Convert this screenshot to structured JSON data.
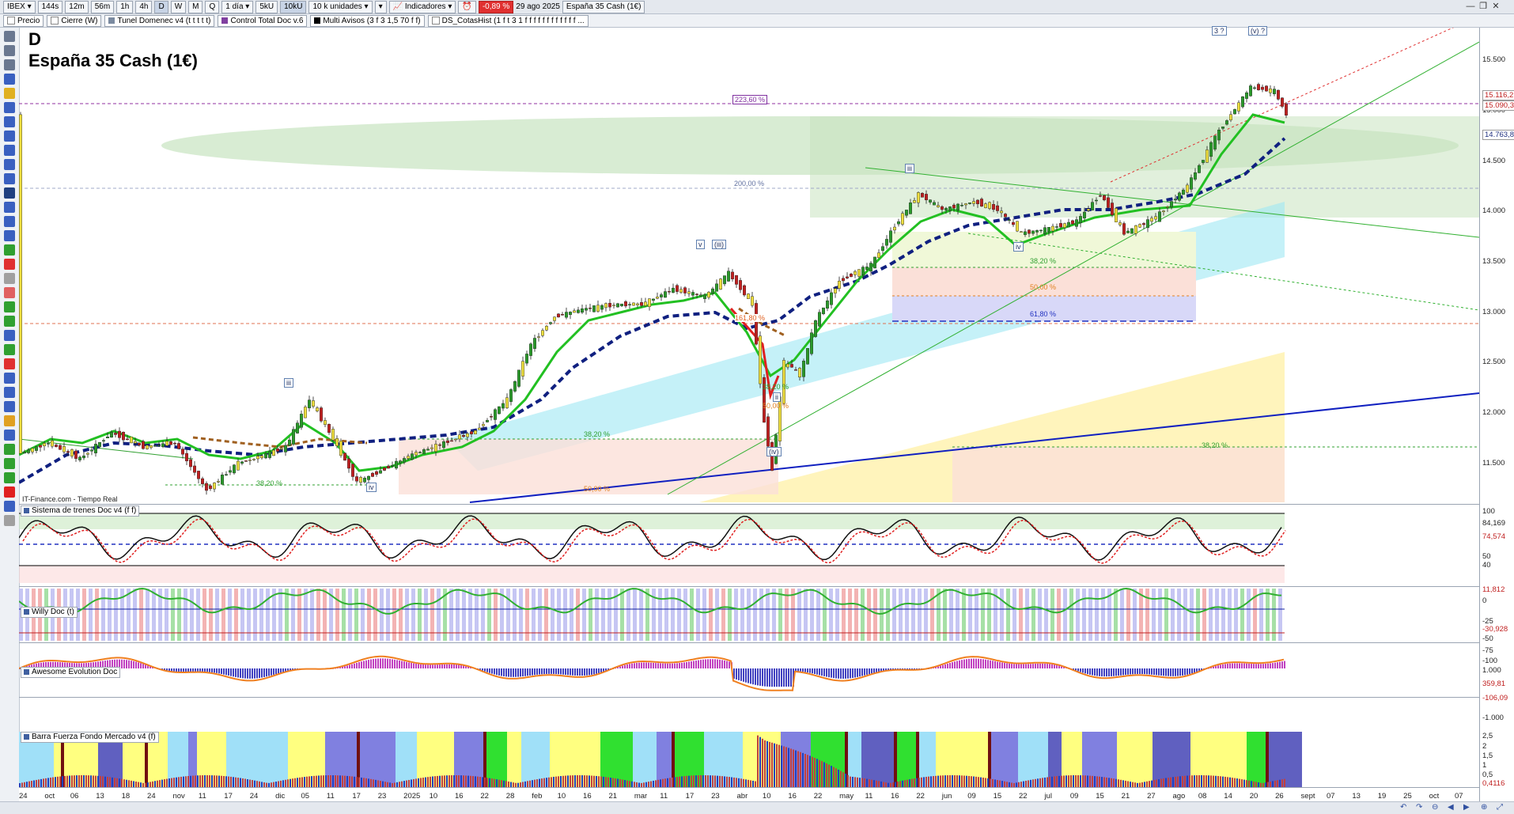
{
  "toolbar": {
    "symbol": "IBEX",
    "timeframes": [
      "144s",
      "12m",
      "56m",
      "1h",
      "4h",
      "D",
      "W",
      "M",
      "Q"
    ],
    "selected_timeframe": "D",
    "ticks": [
      "5kU",
      "10kU"
    ],
    "selected_ticks": "10kU",
    "period": "1 día",
    "units": "10 k unidades",
    "indicators_label": "Indicadores",
    "change": "-0,89 %",
    "date": "29 ago 2025",
    "instrument": "España 35 Cash (1€)"
  },
  "indicator_bar": {
    "items": [
      "Precio",
      "Cierre (W)",
      "Tunel Domenec v4 (t t t t t)",
      "Control Total Doc v.6",
      "Multi Avisos (3 f 3 1,5 70 f f)",
      "DS_CotasHist (1 f t 3 1 f f f f f f f f f f f f ..."
    ]
  },
  "chart": {
    "timeframe_letter": "D",
    "title": "España 35 Cash (1€)",
    "source": "IT-Finance.com - Tiempo Real",
    "price_axis": [
      "15.500",
      "15.000",
      "14.500",
      "14.000",
      "13.500",
      "13.000",
      "12.500",
      "12.000",
      "11.500"
    ],
    "price_tags": [
      {
        "label": "15.116,2",
        "color": "#c02020"
      },
      {
        "label": "15.090,3",
        "color": "#c02020"
      },
      {
        "label": "14.763,8",
        "color": "#203080"
      }
    ],
    "wave_labels": [
      "3 ?",
      "(v) ?",
      "iii",
      "iv",
      "v",
      "(iii)",
      "iii",
      "iv",
      "(iv)",
      "ii",
      "161,80 %"
    ],
    "fib_labels": [
      "223,60 %",
      "200,00 %",
      "38,20 %",
      "50,00 %",
      "61,80 %",
      "38,20 %",
      "50,00 %",
      "38,20 %",
      "38,20 %",
      "38,20 %",
      "50,00 %"
    ]
  },
  "panels": [
    {
      "name": "Sistema de trenes Doc v4 (f f)",
      "axis": [
        "100",
        "84,169",
        "74,574",
        "50",
        "40",
        "11,812",
        "0"
      ]
    },
    {
      "name": "Willy Doc (t)",
      "axis": [
        "-25",
        "-30,928",
        "-50",
        "-75",
        "-100"
      ]
    },
    {
      "name": "Awesome Evolution Doc",
      "axis": [
        "1.000",
        "359,81",
        "-106,09",
        "-1.000"
      ]
    },
    {
      "name": "Barra Fuerza Fondo Mercado v4 (f)",
      "axis": [
        "2,5",
        "2",
        "1,5",
        "1",
        "0,5",
        "0,4116"
      ]
    }
  ],
  "x_axis": [
    "24",
    "oct",
    "06",
    "13",
    "18",
    "24",
    "nov",
    "11",
    "17",
    "24",
    "dic",
    "05",
    "11",
    "17",
    "23",
    "2025",
    "10",
    "16",
    "22",
    "28",
    "feb",
    "10",
    "16",
    "21",
    "mar",
    "11",
    "17",
    "23",
    "abr",
    "10",
    "16",
    "22",
    "may",
    "11",
    "16",
    "22",
    "jun",
    "09",
    "15",
    "22",
    "jul",
    "09",
    "15",
    "21",
    "27",
    "ago",
    "08",
    "14",
    "20",
    "26",
    "sept",
    "07",
    "13",
    "19",
    "25",
    "oct",
    "07"
  ],
  "colors": {
    "candle_up": "#2a9a2a",
    "candle_down": "#c02020",
    "ma_green": "#22c022",
    "ma_red": "#e02020",
    "ma_navy": "#102080",
    "ma_brown": "#a06020",
    "fib_green": "#30a030",
    "fib_orange": "#e08020",
    "fib_blue": "#3040c0"
  }
}
